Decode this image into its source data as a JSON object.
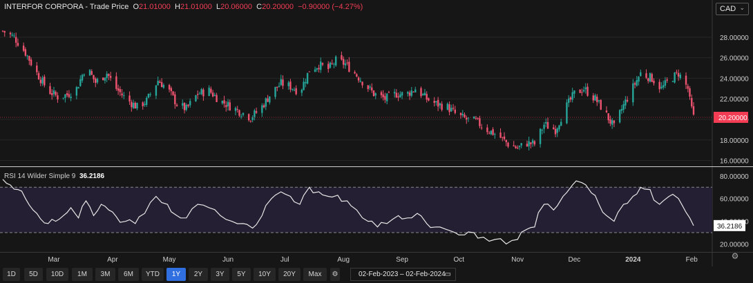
{
  "header": {
    "symbol": "INTERFOR CORPORA",
    "series": " - Trade Price",
    "o_label": "O",
    "open": "21.01000",
    "h_label": "H",
    "high": "21.01000",
    "l_label": "L",
    "low": "20.06000",
    "c_label": "C",
    "close": "20.20000",
    "change": "−0.90000 (−4.27%)",
    "currency": "CAD"
  },
  "rsi_header": {
    "label": "RSI 14 Wilder Simple 9",
    "value": "36.2186"
  },
  "colors": {
    "up": "#26a69a",
    "down": "#ef5370",
    "last_price": "#f23d54",
    "rsi_line": "#e8e8e8",
    "rsi_band": "#241f32",
    "background": "#161616"
  },
  "chart_data": [
    {
      "type": "candlestick",
      "title": "INTERFOR CORPORA - Trade Price",
      "y_ticks": [
        "28.00000",
        "26.00000",
        "24.00000",
        "22.00000",
        "20.00000",
        "18.00000",
        "16.00000"
      ],
      "ylim": [
        15.5,
        29.6
      ],
      "last_value": 20.2,
      "last_value_label": "20.20000",
      "x_months": [
        "Mar",
        "Apr",
        "May",
        "Jun",
        "Jul",
        "Aug",
        "Sep",
        "Oct",
        "Nov",
        "Dec",
        "2024",
        "Feb"
      ],
      "x_start": "2023-02-02",
      "x_end": "2024-02-02",
      "close_path": [
        [
          "2023-02-02",
          28.6
        ],
        [
          "2023-02-08",
          28.0
        ],
        [
          "2023-02-14",
          26.5
        ],
        [
          "2023-02-20",
          24.5
        ],
        [
          "2023-02-26",
          22.8
        ],
        [
          "2023-03-03",
          22.2
        ],
        [
          "2023-03-08",
          22.4
        ],
        [
          "2023-03-13",
          23.0
        ],
        [
          "2023-03-18",
          25.2
        ],
        [
          "2023-03-23",
          23.6
        ],
        [
          "2023-03-29",
          24.5
        ],
        [
          "2023-04-03",
          23.0
        ],
        [
          "2023-04-08",
          22.0
        ],
        [
          "2023-04-14",
          21.2
        ],
        [
          "2023-04-19",
          21.8
        ],
        [
          "2023-04-25",
          23.8
        ],
        [
          "2023-04-30",
          23.0
        ],
        [
          "2023-05-05",
          21.5
        ],
        [
          "2023-05-10",
          21.0
        ],
        [
          "2023-05-16",
          22.5
        ],
        [
          "2023-05-22",
          22.8
        ],
        [
          "2023-05-28",
          21.8
        ],
        [
          "2023-06-03",
          21.2
        ],
        [
          "2023-06-08",
          20.7
        ],
        [
          "2023-06-13",
          20.2
        ],
        [
          "2023-06-18",
          21.0
        ],
        [
          "2023-06-24",
          22.6
        ],
        [
          "2023-06-29",
          23.5
        ],
        [
          "2023-07-04",
          23.2
        ],
        [
          "2023-07-09",
          22.7
        ],
        [
          "2023-07-14",
          24.8
        ],
        [
          "2023-07-19",
          25.3
        ],
        [
          "2023-07-24",
          24.9
        ],
        [
          "2023-07-28",
          25.7
        ],
        [
          "2023-08-02",
          25.4
        ],
        [
          "2023-08-07",
          24.5
        ],
        [
          "2023-08-12",
          23.5
        ],
        [
          "2023-08-17",
          22.5
        ],
        [
          "2023-08-23",
          22.0
        ],
        [
          "2023-08-29",
          22.5
        ],
        [
          "2023-09-03",
          22.4
        ],
        [
          "2023-09-08",
          23.0
        ],
        [
          "2023-09-14",
          22.0
        ],
        [
          "2023-09-19",
          21.5
        ],
        [
          "2023-09-25",
          21.2
        ],
        [
          "2023-09-30",
          20.4
        ],
        [
          "2023-10-05",
          20.0
        ],
        [
          "2023-10-10",
          19.8
        ],
        [
          "2023-10-16",
          19.0
        ],
        [
          "2023-10-22",
          18.4
        ],
        [
          "2023-10-27",
          17.6
        ],
        [
          "2023-11-01",
          17.2
        ],
        [
          "2023-11-06",
          17.7
        ],
        [
          "2023-11-10",
          17.6
        ],
        [
          "2023-11-15",
          19.5
        ],
        [
          "2023-11-21",
          19.0
        ],
        [
          "2023-11-26",
          21.0
        ],
        [
          "2023-12-01",
          22.5
        ],
        [
          "2023-12-06",
          23.0
        ],
        [
          "2023-12-12",
          22.0
        ],
        [
          "2023-12-16",
          21.0
        ],
        [
          "2023-12-22",
          19.2
        ],
        [
          "2023-12-26",
          21.0
        ],
        [
          "2023-12-31",
          22.8
        ],
        [
          "2024-01-05",
          24.5
        ],
        [
          "2024-01-11",
          24.0
        ],
        [
          "2024-01-16",
          23.0
        ],
        [
          "2024-01-20",
          23.8
        ],
        [
          "2024-01-25",
          24.5
        ],
        [
          "2024-01-30",
          23.0
        ],
        [
          "2024-01-31",
          21.8
        ],
        [
          "2024-02-01",
          21.0
        ],
        [
          "2024-02-02",
          20.2
        ]
      ]
    },
    {
      "type": "line",
      "title": "RSI 14 Wilder Simple 9",
      "y_ticks": [
        "80.00000",
        "60.00000",
        "40.00000",
        "20.00000"
      ],
      "ylim": [
        13,
        86
      ],
      "bands": [
        30,
        70
      ],
      "last_value": 36.2186,
      "last_value_label": "36.2186",
      "x_start": "2023-02-02",
      "x_end": "2024-02-02",
      "points": [
        [
          "2023-02-02",
          77
        ],
        [
          "2023-02-06",
          72
        ],
        [
          "2023-02-10",
          68
        ],
        [
          "2023-02-14",
          60
        ],
        [
          "2023-02-18",
          50
        ],
        [
          "2023-02-22",
          42
        ],
        [
          "2023-02-26",
          38
        ],
        [
          "2023-03-02",
          40
        ],
        [
          "2023-03-06",
          45
        ],
        [
          "2023-03-10",
          52
        ],
        [
          "2023-03-14",
          43
        ],
        [
          "2023-03-18",
          58
        ],
        [
          "2023-03-22",
          45
        ],
        [
          "2023-03-26",
          55
        ],
        [
          "2023-03-30",
          50
        ],
        [
          "2023-04-03",
          44
        ],
        [
          "2023-04-08",
          40
        ],
        [
          "2023-04-13",
          38
        ],
        [
          "2023-04-18",
          47
        ],
        [
          "2023-04-24",
          62
        ],
        [
          "2023-04-30",
          55
        ],
        [
          "2023-05-05",
          45
        ],
        [
          "2023-05-10",
          43
        ],
        [
          "2023-05-16",
          55
        ],
        [
          "2023-05-22",
          52
        ],
        [
          "2023-05-28",
          45
        ],
        [
          "2023-06-03",
          40
        ],
        [
          "2023-06-09",
          38
        ],
        [
          "2023-06-14",
          34
        ],
        [
          "2023-06-19",
          45
        ],
        [
          "2023-06-24",
          60
        ],
        [
          "2023-06-29",
          66
        ],
        [
          "2023-07-04",
          62
        ],
        [
          "2023-07-09",
          55
        ],
        [
          "2023-07-14",
          70
        ],
        [
          "2023-07-19",
          66
        ],
        [
          "2023-07-24",
          62
        ],
        [
          "2023-07-29",
          63
        ],
        [
          "2023-08-03",
          58
        ],
        [
          "2023-08-08",
          50
        ],
        [
          "2023-08-14",
          40
        ],
        [
          "2023-08-19",
          35
        ],
        [
          "2023-08-24",
          38
        ],
        [
          "2023-08-30",
          45
        ],
        [
          "2023-09-04",
          43
        ],
        [
          "2023-09-09",
          47
        ],
        [
          "2023-09-14",
          38
        ],
        [
          "2023-09-19",
          35
        ],
        [
          "2023-09-24",
          33
        ],
        [
          "2023-09-29",
          30
        ],
        [
          "2023-10-04",
          28
        ],
        [
          "2023-10-09",
          30
        ],
        [
          "2023-10-14",
          26
        ],
        [
          "2023-10-20",
          24
        ],
        [
          "2023-10-26",
          20
        ],
        [
          "2023-11-01",
          24
        ],
        [
          "2023-11-06",
          33
        ],
        [
          "2023-11-10",
          35
        ],
        [
          "2023-11-15",
          55
        ],
        [
          "2023-11-20",
          50
        ],
        [
          "2023-11-25",
          62
        ],
        [
          "2023-11-30",
          72
        ],
        [
          "2023-12-05",
          74
        ],
        [
          "2023-12-10",
          65
        ],
        [
          "2023-12-14",
          55
        ],
        [
          "2023-12-18",
          45
        ],
        [
          "2023-12-22",
          40
        ],
        [
          "2023-12-27",
          55
        ],
        [
          "2024-01-01",
          62
        ],
        [
          "2024-01-05",
          70
        ],
        [
          "2024-01-10",
          68
        ],
        [
          "2024-01-15",
          55
        ],
        [
          "2024-01-20",
          62
        ],
        [
          "2024-01-25",
          60
        ],
        [
          "2024-01-29",
          48
        ],
        [
          "2024-02-02",
          36.2
        ]
      ]
    }
  ],
  "range_buttons": [
    "1D",
    "5D",
    "10D",
    "1M",
    "3M",
    "6M",
    "YTD",
    "1Y",
    "2Y",
    "3Y",
    "5Y",
    "10Y",
    "20Y",
    "Max"
  ],
  "selected_range": "1Y",
  "date_range": {
    "from": "02-Feb-2023",
    "sep": "–",
    "to": "02-Feb-2024"
  }
}
